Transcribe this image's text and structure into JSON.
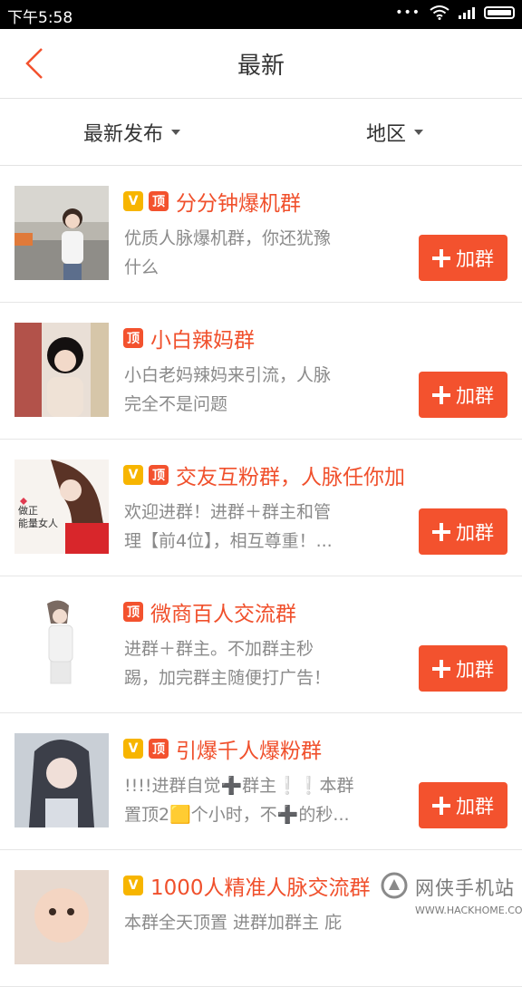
{
  "status_bar": {
    "time": "下午5:58",
    "dots": "•••"
  },
  "header": {
    "title": "最新"
  },
  "filters": {
    "sort_label": "最新发布",
    "region_label": "地区"
  },
  "join_label": "加群",
  "groups": [
    {
      "name": "分分钟爆机群",
      "vip": true,
      "top": true,
      "desc": "优质人脉爆机群，你还犹豫\n什么"
    },
    {
      "name": "小白辣妈群",
      "vip": false,
      "top": true,
      "desc": "小白老妈辣妈来引流，人脉\n完全不是问题"
    },
    {
      "name": "交友互粉群，人脉任你加",
      "vip": true,
      "top": true,
      "desc": "欢迎进群！进群＋群主和管\n理【前4位】，相互尊重！...",
      "avatar_text": "做正\n能量女人"
    },
    {
      "name": "微商百人交流群",
      "vip": false,
      "top": true,
      "desc": "进群＋群主。不加群主秒\n踢，加完群主随便打广告！"
    },
    {
      "name": "引爆千人爆粉群",
      "vip": true,
      "top": true,
      "desc": "!!!!进群自觉➕群主❕❕本群\n置顶2🟨个小时，不➕的秒..."
    },
    {
      "name": "1000人精准人脉交流群",
      "vip": true,
      "top": false,
      "desc": "本群全天顶置 进群加群主 庇"
    }
  ],
  "badges": {
    "v": "V",
    "top": "顶"
  },
  "watermark": {
    "main": "网侠手机站",
    "sub": "WWW.HACKHOME.COM"
  }
}
